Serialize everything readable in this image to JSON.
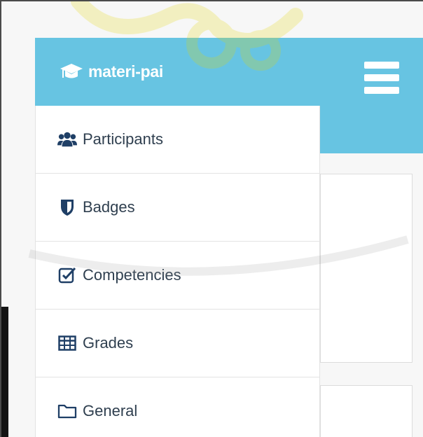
{
  "sidebar": {
    "brand": {
      "label": "materi-pai",
      "icon": "graduation-cap-icon"
    },
    "items": [
      {
        "label": "Participants",
        "icon": "users-icon"
      },
      {
        "label": "Badges",
        "icon": "shield-icon"
      },
      {
        "label": "Competencies",
        "icon": "check-square-icon"
      },
      {
        "label": "Grades",
        "icon": "table-icon"
      },
      {
        "label": "General",
        "icon": "folder-icon"
      }
    ]
  },
  "header": {
    "menu_icon": "hamburger-icon"
  },
  "colors": {
    "brand": "#67c4e2",
    "nav_text": "#2f3f4f",
    "icon_color": "#1f3f66",
    "watermark": "#e3d700"
  }
}
